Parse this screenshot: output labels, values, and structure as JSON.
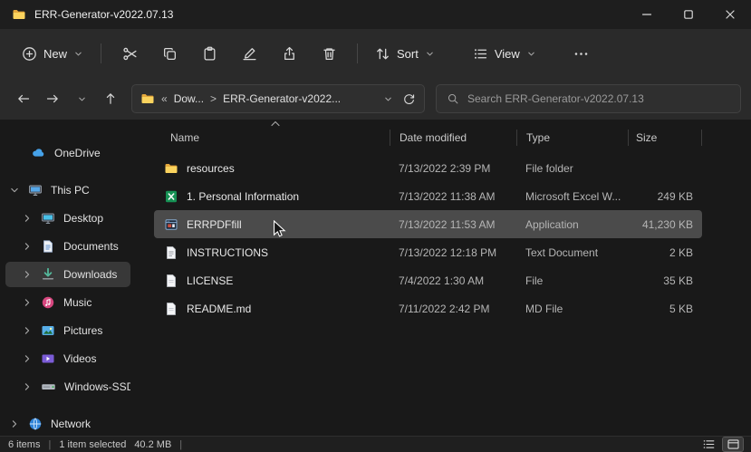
{
  "window": {
    "title": "ERR-Generator-v2022.07.13"
  },
  "toolbar": {
    "new": "New",
    "sort": "Sort",
    "view": "View"
  },
  "address": {
    "prefix": "«",
    "separator": ">",
    "segments": [
      "Dow...",
      "ERR-Generator-v2022..."
    ]
  },
  "search": {
    "placeholder": "Search ERR-Generator-v2022.07.13"
  },
  "sidebar": {
    "items": [
      {
        "label": "OneDrive",
        "icon": "cloud-icon"
      },
      {
        "label": "This PC",
        "icon": "computer-icon",
        "expanded": true
      },
      {
        "label": "Desktop",
        "icon": "desktop-icon"
      },
      {
        "label": "Documents",
        "icon": "documents-icon"
      },
      {
        "label": "Downloads",
        "icon": "downloads-icon",
        "selected": true
      },
      {
        "label": "Music",
        "icon": "music-icon"
      },
      {
        "label": "Pictures",
        "icon": "pictures-icon"
      },
      {
        "label": "Videos",
        "icon": "videos-icon"
      },
      {
        "label": "Windows-SSD (",
        "icon": "drive-icon"
      },
      {
        "label": "Network",
        "icon": "network-icon"
      }
    ]
  },
  "files": {
    "columns": {
      "name": "Name",
      "date": "Date modified",
      "type": "Type",
      "size": "Size"
    },
    "sort": {
      "column": "Name",
      "direction": "ascending"
    },
    "rows": [
      {
        "name": "resources",
        "date": "7/13/2022 2:39 PM",
        "type": "File folder",
        "size": "",
        "icon": "folder-icon"
      },
      {
        "name": "1. Personal Information",
        "date": "7/13/2022 11:38 AM",
        "type": "Microsoft Excel W...",
        "size": "249 KB",
        "icon": "excel-icon"
      },
      {
        "name": "ERRPDFfill",
        "date": "7/13/2022 11:53 AM",
        "type": "Application",
        "size": "41,230 KB",
        "icon": "application-icon",
        "selected": true
      },
      {
        "name": "INSTRUCTIONS",
        "date": "7/13/2022 12:18 PM",
        "type": "Text Document",
        "size": "2 KB",
        "icon": "text-document-icon"
      },
      {
        "name": "LICENSE",
        "date": "7/4/2022 1:30 AM",
        "type": "File",
        "size": "35 KB",
        "icon": "file-icon"
      },
      {
        "name": "README.md",
        "date": "7/11/2022 2:42 PM",
        "type": "MD File",
        "size": "5 KB",
        "icon": "file-icon"
      }
    ]
  },
  "status": {
    "items": "6 items",
    "separator": "|",
    "selected": "1 item selected",
    "size": "40.2 MB"
  },
  "colors": {
    "selection_row": "#4b4b4b",
    "sidebar_selection": "#383838",
    "folder_yellow": "#f5c94d",
    "excel_green": "#169154",
    "onedrive_blue": "#46a2e9"
  }
}
